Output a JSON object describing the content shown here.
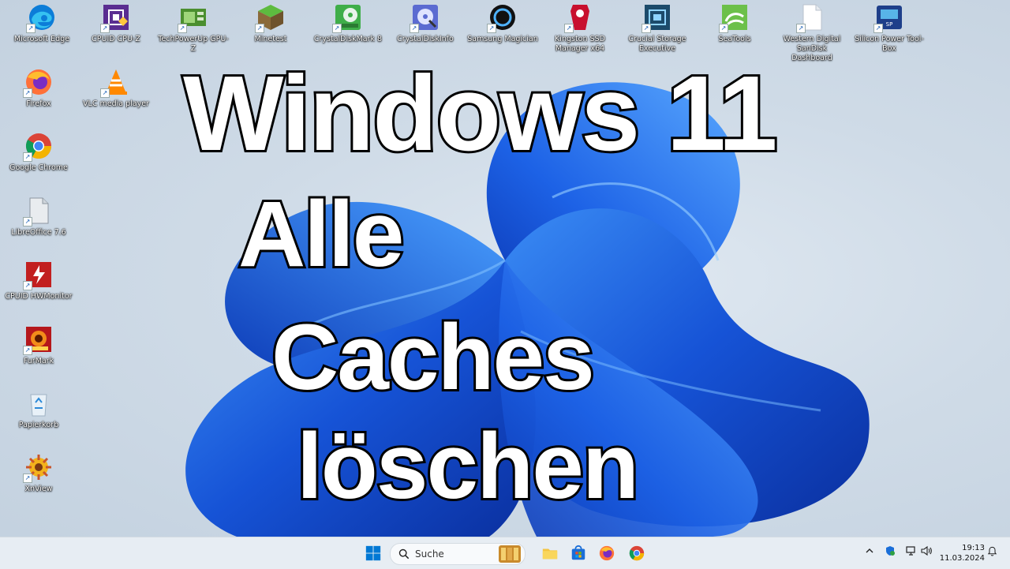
{
  "desktop": {
    "icons": [
      {
        "label": "Microsoft Edge",
        "icon": "edge-icon"
      },
      {
        "label": "CPUID CPU-Z",
        "icon": "cpuz-icon"
      },
      {
        "label": "TechPowerUp GPU-Z",
        "icon": "gpuz-icon"
      },
      {
        "label": "Minetest",
        "icon": "minetest-icon"
      },
      {
        "label": "CrystalDiskMark 8",
        "icon": "crystaldiskmark-icon"
      },
      {
        "label": "CrystalDiskInfo",
        "icon": "crystaldiskinfo-icon"
      },
      {
        "label": "Samsung Magician",
        "icon": "samsung-magician-icon"
      },
      {
        "label": "Kingston SSD Manager x64",
        "icon": "kingston-icon"
      },
      {
        "label": "Crucial Storage Executive",
        "icon": "crucial-icon"
      },
      {
        "label": "SeaTools",
        "icon": "seatools-icon"
      },
      {
        "label": "Western Digital SanDisk Dashboard",
        "icon": "document-icon"
      },
      {
        "label": "Silicon Power Tool-Box",
        "icon": "silicon-power-icon"
      },
      {
        "label": "Firefox",
        "icon": "firefox-icon"
      },
      {
        "label": "VLC media player",
        "icon": "vlc-icon"
      },
      {
        "label": "Google Chrome",
        "icon": "chrome-icon"
      },
      {
        "label": "LibreOffice 7.6",
        "icon": "libreoffice-icon"
      },
      {
        "label": "CPUID HWMonitor",
        "icon": "hwmonitor-icon"
      },
      {
        "label": "FurMark",
        "icon": "furmark-icon"
      },
      {
        "label": "Papierkorb",
        "icon": "recycle-bin-icon"
      },
      {
        "label": "XnView",
        "icon": "xnview-icon"
      }
    ]
  },
  "overlay": {
    "line1": "Windows 11",
    "line2": "Alle",
    "line3": "Caches",
    "line4": "löschen"
  },
  "taskbar": {
    "search_placeholder": "Suche",
    "clock_time": "19:13",
    "clock_date": "11.03.2024"
  },
  "colors": {
    "accent": "#0067c0",
    "taskbar_bg": "#e7edf3",
    "wallpaper_blue": "#1456d8"
  }
}
